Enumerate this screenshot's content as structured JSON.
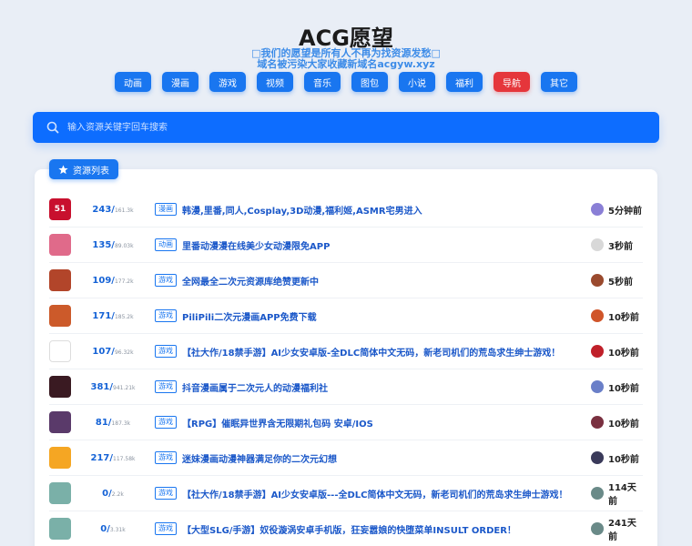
{
  "header": {
    "title": "ACG愿望",
    "tagline_1": "□我们的愿望是所有人不再为找资源发愁□",
    "tagline_2": "域名被污染大家收藏新域名acgyw.xyz"
  },
  "nav": {
    "items": [
      {
        "label": "动画",
        "color": "#1976f0"
      },
      {
        "label": "漫画",
        "color": "#1976f0"
      },
      {
        "label": "游戏",
        "color": "#1976f0"
      },
      {
        "label": "视频",
        "color": "#1976f0"
      },
      {
        "label": "音乐",
        "color": "#1976f0"
      },
      {
        "label": "图包",
        "color": "#1976f0"
      },
      {
        "label": "小说",
        "color": "#1976f0"
      },
      {
        "label": "福利",
        "color": "#1976f0"
      },
      {
        "label": "导航",
        "color": "#e5363b"
      },
      {
        "label": "其它",
        "color": "#1976f0"
      }
    ]
  },
  "search": {
    "placeholder": "输入资源关键字回车搜索"
  },
  "section": {
    "label": "资源列表",
    "icon": "star-icon"
  },
  "rows": [
    {
      "thumb_color": "#c8102e",
      "thumb_text": "51",
      "count": "243",
      "views": "161.3k",
      "category": "漫画",
      "title": "韩漫,里番,同人,Cosplay,3D动漫,福利姬,ASMR宅男进入",
      "avatar_color": "#8a7fd6",
      "time": "5分钟前"
    },
    {
      "thumb_color": "#e06a8a",
      "thumb_text": "",
      "count": "135",
      "views": "89.03k",
      "category": "动画",
      "title": "里番动漫漫在线美少女动漫限免APP",
      "avatar_color": "#d8d8d8",
      "time": "3秒前"
    },
    {
      "thumb_color": "#b2452a",
      "thumb_text": "",
      "count": "109",
      "views": "177.2k",
      "category": "游戏",
      "title": "全网最全二次元资源库绝赞更新中",
      "avatar_color": "#9a4a2e",
      "time": "5秒前"
    },
    {
      "thumb_color": "#cc5a2a",
      "thumb_text": "",
      "count": "171",
      "views": "185.2k",
      "category": "游戏",
      "title": "PiliPili二次元漫画APP免费下载",
      "avatar_color": "#d0552a",
      "time": "10秒前"
    },
    {
      "thumb_color": "#ffffff",
      "thumb_text": "",
      "count": "107",
      "views": "96.32k",
      "category": "游戏",
      "title": "【社大作/18禁手游】AI少女安卓版-全DLC简体中文无码，新老司机们的荒岛求生绅士游戏！",
      "avatar_color": "#c0202a",
      "time": "10秒前"
    },
    {
      "thumb_color": "#3a1a22",
      "thumb_text": "",
      "count": "381",
      "views": "941.21k",
      "category": "游戏",
      "title": "抖音漫画属于二次元人的动漫福利社",
      "avatar_color": "#6a7fc8",
      "time": "10秒前"
    },
    {
      "thumb_color": "#5a3a6a",
      "thumb_text": "",
      "count": "81",
      "views": "187.3k",
      "category": "游戏",
      "title": "【RPG】催眠异世界含无限期礼包码 安卓/IOS",
      "avatar_color": "#7a3040",
      "time": "10秒前"
    },
    {
      "thumb_color": "#f5a623",
      "thumb_text": "",
      "count": "217",
      "views": "117.58k",
      "category": "游戏",
      "title": "迷妹漫画动漫神器满足你的二次元幻想",
      "avatar_color": "#3a3a5a",
      "time": "10秒前"
    },
    {
      "thumb_color": "#7ab0a8",
      "thumb_text": "",
      "count": "0",
      "views": "2.2k",
      "category": "游戏",
      "title": "【社大作/18禁手游】AI少女安卓版---全DLC简体中文无码，新老司机们的荒岛求生绅士游戏！",
      "avatar_color": "#6a8a88",
      "time": "114天前"
    },
    {
      "thumb_color": "#7ab0a8",
      "thumb_text": "",
      "count": "0",
      "views": "3.31k",
      "category": "游戏",
      "title": "【大型SLG/手游】奴役漩涡安卓手机版，狂妄嚣娘的快堕菜单INSULT ORDER！",
      "avatar_color": "#6a8a88",
      "time": "241天前"
    }
  ]
}
